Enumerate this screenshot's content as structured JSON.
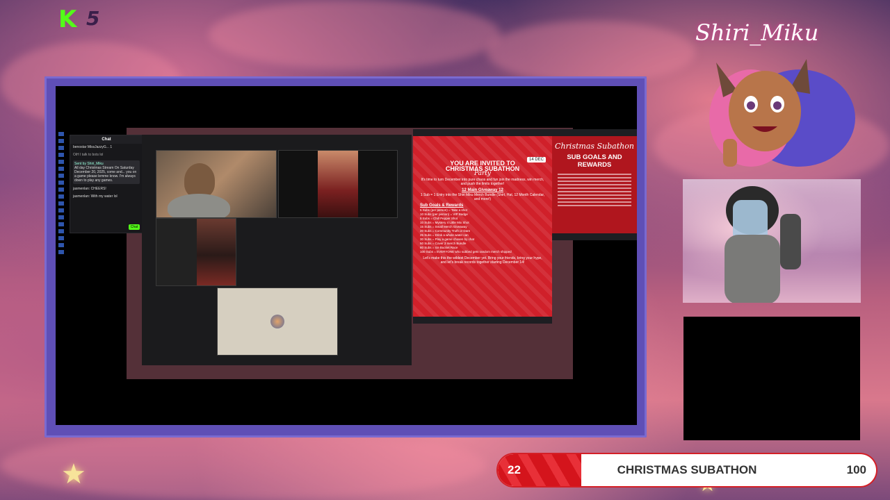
{
  "branding": {
    "platform_logo": "K",
    "platform_number": "5",
    "streamer_name": "Shiri_Miku"
  },
  "chat": {
    "header": "Chat",
    "top_row": "benostar  MissJazzyG... 1",
    "top_row_sub": "OiH I talk to bots lol",
    "pinned_by": "Sent by Shiri_Miku",
    "pinned_text": "All day Christmas Stream On Saturday December 20, 2025, come and... you on a game please lemme know. I'm always down to play any games.",
    "msg1": "jasmenlan: CHEERS!",
    "msg2": "jasmenlan: With my water lol",
    "send_label": "Chat"
  },
  "flyer": {
    "date_badge": "14 DEC",
    "invited": "YOU ARE INVITED TO",
    "title": "CHRISTMAS SUBATHON",
    "script": "Party",
    "intro": "It's time to turn December into pure chaos and fun join the madness, win merch, and push the limits together!",
    "giveaway_title": "12 Main Giveaway 12",
    "giveaway_text": "1 Sub = 1 Entry into the Shiri Miku Merch Bundle (Shirt, Hat, 12 Month Calendar, and more!)",
    "goals_title": "Sub Goals & Rewards",
    "goals": [
      "5 Subs (per person) = Take a shot",
      "10 Subs (per person) = VIP Badge",
      "5 Subs = Chill Pepper Shot",
      "10 Subs = Mystery 4 Little Mix Shot",
      "15 Subs = Small Merch Giveaway",
      "20 Subs = Community Truth or Dare",
      "25 Subs = Drink a whole water can",
      "30 Subs = Play a game chosen by chat",
      "50 Subs = Cover 3 merch Bundle",
      "80 Subs = Ice Bucket Race",
      "100 Subs = EVERYONE who subbed gets random merch shipped"
    ],
    "outro": "Let's make this the wildest December yet. Bring your friends, bring your hype, and let's break records together starting December 14!"
  },
  "goals_window": {
    "script": "Christmas Subathon",
    "heading": "SUB GOALS AND REWARDS"
  },
  "progress": {
    "current": "22",
    "label": "CHRISTMAS SUBATHON",
    "target": "100",
    "fraction": 0.22,
    "fill_color": "#d4141c"
  }
}
